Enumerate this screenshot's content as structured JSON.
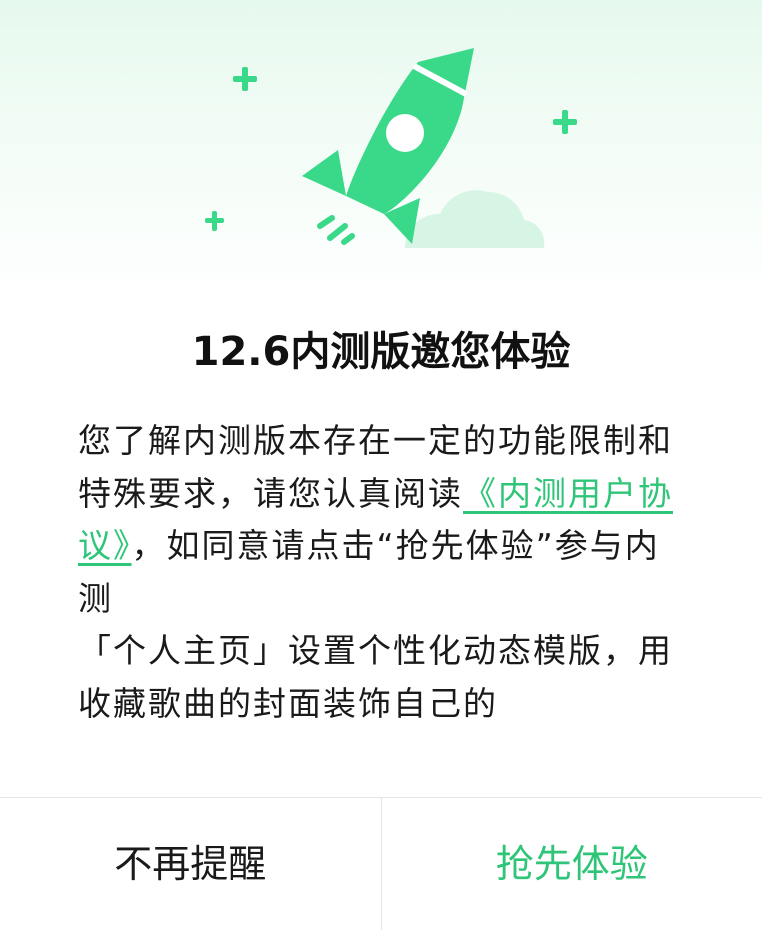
{
  "dialog": {
    "title": "12.6内测版邀您体验",
    "body": {
      "intro": "您了解内测版本存在一定的功能限制和特殊要求，请您认真阅读",
      "agreement_link": "《内测用户协议》",
      "after_link": "，如同意请点击“抢先体验”参与内测",
      "feature": "「个人主页」设置个性化动态模版，用收藏歌曲的封面装饰自己的"
    },
    "buttons": {
      "dismiss": "不再提醒",
      "join": "抢先体验"
    }
  },
  "colors": {
    "accent": "#2fc578",
    "rocket": "#3ad98a",
    "cloud": "#d4f5e3",
    "text": "#1a1a1a"
  },
  "icons": {
    "hero": "rocket-illustration",
    "sparkles": "plus-sparkle-icon"
  }
}
